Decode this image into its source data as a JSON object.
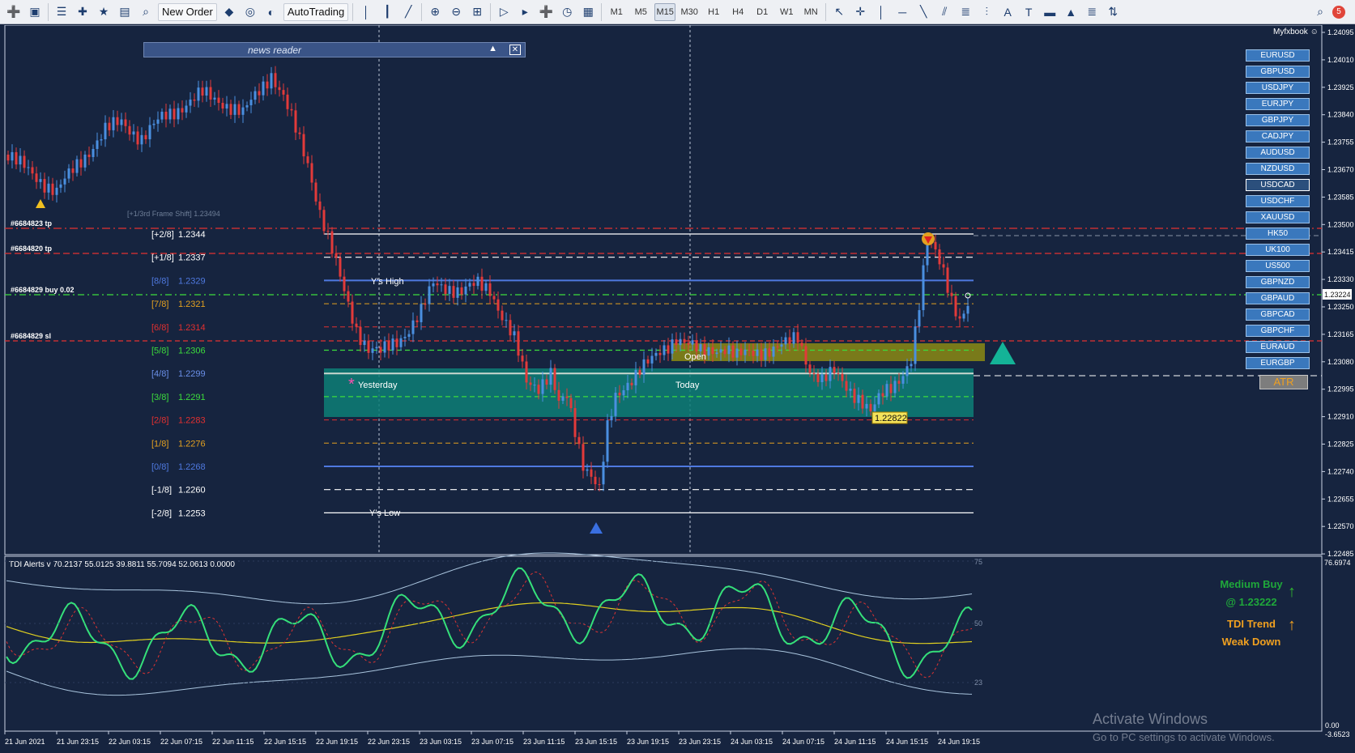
{
  "toolbar": {
    "new_order_label": "New Order",
    "autotrading_label": "AutoTrading",
    "timeframes": [
      "M1",
      "M5",
      "M15",
      "M30",
      "H1",
      "H4",
      "D1",
      "W1",
      "MN"
    ],
    "active_timeframe": "M15",
    "notification_count": "5"
  },
  "broker_label": "Myfxbook",
  "news_reader": {
    "title": "news reader"
  },
  "symbols": [
    "EURUSD",
    "GBPUSD",
    "USDJPY",
    "EURJPY",
    "GBPJPY",
    "CADJPY",
    "AUDUSD",
    "NZDUSD",
    "USDCAD",
    "USDCHF",
    "XAUUSD",
    "HK50",
    "UK100",
    "US500",
    "GBPNZD",
    "GBPAUD",
    "GBPCAD",
    "GBPCHF",
    "EURAUD",
    "EURGBP"
  ],
  "active_symbol": "USDCAD",
  "atr_button": "ATR",
  "price_axis": {
    "ticks": [
      "1.24095",
      "1.24010",
      "1.23925",
      "1.23840",
      "1.23755",
      "1.23670",
      "1.23585",
      "1.23500",
      "1.23415",
      "1.23330",
      "1.23250",
      "1.23165",
      "1.23080",
      "1.22995",
      "1.22910",
      "1.22825",
      "1.22740",
      "1.22655",
      "1.22570",
      "1.22485"
    ],
    "current_price": "1.23224"
  },
  "murrey_levels": [
    {
      "label": "[+2/8]",
      "price": "1.2344",
      "color": "#ffffff"
    },
    {
      "label": "[+1/8]",
      "price": "1.2337",
      "color": "#ffffff"
    },
    {
      "label": "[8/8]",
      "price": "1.2329",
      "color": "#4f79e0"
    },
    {
      "label": "[7/8]",
      "price": "1.2321",
      "color": "#e2a020"
    },
    {
      "label": "[6/8]",
      "price": "1.2314",
      "color": "#e23030"
    },
    {
      "label": "[5/8]",
      "price": "1.2306",
      "color": "#3cdc3c"
    },
    {
      "label": "[4/8]",
      "price": "1.2299",
      "color": "#6a8fe8"
    },
    {
      "label": "[3/8]",
      "price": "1.2291",
      "color": "#3cdc3c"
    },
    {
      "label": "[2/8]",
      "price": "1.2283",
      "color": "#e23030"
    },
    {
      "label": "[1/8]",
      "price": "1.2276",
      "color": "#e2a020"
    },
    {
      "label": "[0/8]",
      "price": "1.2268",
      "color": "#4f79e0"
    },
    {
      "label": "[-1/8]",
      "price": "1.2260",
      "color": "#ffffff"
    },
    {
      "label": "[-2/8]",
      "price": "1.2253",
      "color": "#ffffff"
    }
  ],
  "frame_shift": "[+1/3rd Frame Shift]  1.23494",
  "orders": [
    "#6684823 tp",
    "#6684820 tp",
    "#6684829 buy 0.02",
    "#6684829 sl"
  ],
  "chart_labels": {
    "ys_high": "Y's High",
    "ys_low": "Y's Low",
    "yesterday": "Yesterday",
    "today": "Today",
    "open": "Open",
    "low_price": "1.22822"
  },
  "indicator": {
    "header": "TDI Alerts v 70.2137 55.0125 39.8811 55.7094 52.0613 0.0000",
    "levels": [
      "75",
      "50",
      "23"
    ],
    "axis_top": "76.6974",
    "axis_bottom": "0.00",
    "axis_min": "-3.6523"
  },
  "signals": {
    "line1": "Medium Buy",
    "line2": "@ 1.23222",
    "trend_title": "TDI Trend",
    "trend_value": "Weak Down"
  },
  "time_axis": [
    "21 Jun 2021",
    "21 Jun 23:15",
    "22 Jun 03:15",
    "22 Jun 07:15",
    "22 Jun 11:15",
    "22 Jun 15:15",
    "22 Jun 19:15",
    "22 Jun 23:15",
    "23 Jun 03:15",
    "23 Jun 07:15",
    "23 Jun 11:15",
    "23 Jun 15:15",
    "23 Jun 19:15",
    "23 Jun 23:15",
    "24 Jun 03:15",
    "24 Jun 07:15",
    "24 Jun 11:15",
    "24 Jun 15:15",
    "24 Jun 19:15"
  ],
  "watermark": {
    "title": "Activate Windows",
    "subtitle": "Go to PC settings to activate Windows."
  },
  "colors": {
    "background": "#16243f",
    "bull_candle": "#4a8fe0",
    "bear_candle": "#e23a3a",
    "tdi_green": "#35e07a",
    "tdi_yellow": "#e0d020"
  }
}
